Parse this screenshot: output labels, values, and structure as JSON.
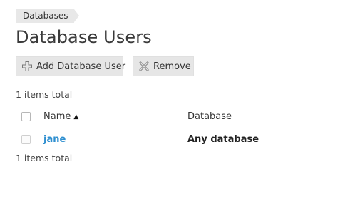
{
  "breadcrumb": {
    "items": [
      {
        "label": "Databases"
      }
    ]
  },
  "page": {
    "title": "Database Users"
  },
  "toolbar": {
    "add_label": "Add Database User",
    "add_icon": "plus-icon",
    "remove_label": "Remove",
    "remove_icon": "close-icon"
  },
  "list": {
    "count_text": "1 items total",
    "columns": {
      "name": "Name",
      "database": "Database"
    },
    "sort": {
      "column": "name",
      "direction": "ascending"
    },
    "rows": [
      {
        "name": "jane",
        "database": "Any database",
        "checked": false
      }
    ]
  },
  "colors": {
    "link": "#2e8fd0",
    "button_bg": "#e6e6e6",
    "breadcrumb_bg": "#e8e8e8"
  }
}
